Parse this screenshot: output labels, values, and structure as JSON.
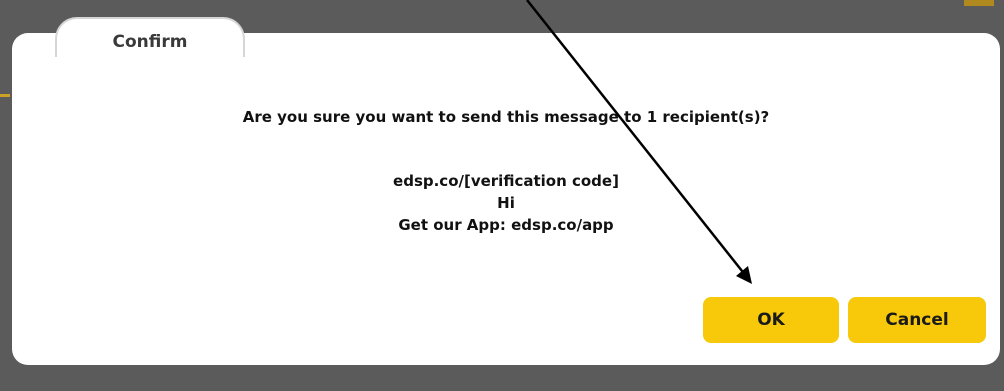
{
  "dialog": {
    "tab_title": "Confirm",
    "question": "Are you sure you want to send this message to 1 recipient(s)?",
    "message_lines": [
      "edsp.co/[verification code]",
      "Hi",
      "Get our App: edsp.co/app"
    ],
    "ok_label": "OK",
    "cancel_label": "Cancel"
  },
  "colors": {
    "backdrop": "#5b5b5b",
    "dialog_bg": "#ffffff",
    "button_bg": "#f7c90a",
    "text": "#111111"
  },
  "annotation": {
    "icon": "arrow-pointer-icon",
    "target": "ok-button"
  }
}
